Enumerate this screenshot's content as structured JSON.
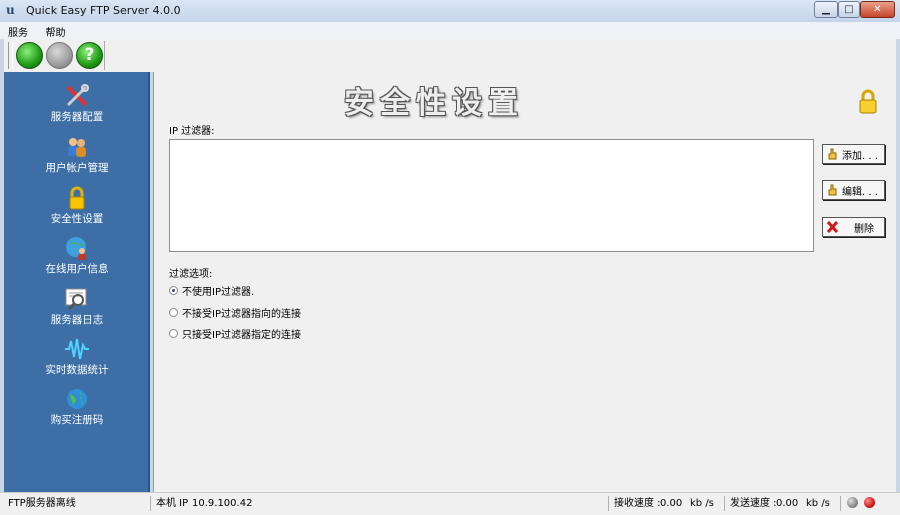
{
  "window": {
    "title": "Quick Easy FTP Server 4.0.0",
    "app_icon": "u-logo-icon"
  },
  "menu": [
    "服务",
    "帮助"
  ],
  "toolbar": {
    "start": "start-server-icon",
    "stop": "stop-server-icon",
    "help": "?"
  },
  "sidebar": {
    "items": [
      {
        "label": "服务器配置",
        "icon": "tools-icon"
      },
      {
        "label": "用户帐户管理",
        "icon": "users-icon"
      },
      {
        "label": "安全性设置",
        "icon": "lock-icon"
      },
      {
        "label": "在线用户信息",
        "icon": "online-users-icon"
      },
      {
        "label": "服务器日志",
        "icon": "log-magnifier-icon"
      },
      {
        "label": "实时数据统计",
        "icon": "waveform-icon"
      },
      {
        "label": "购买注册码",
        "icon": "globe-icon"
      }
    ]
  },
  "main": {
    "heading": "安全性设置",
    "ip_filter_label": "IP 过滤器:",
    "buttons": {
      "add": "添加. . .",
      "edit": "编辑. . .",
      "delete": "删除"
    },
    "filter_options_label": "过滤选项:",
    "options": [
      {
        "label": "不使用IP过滤器.",
        "selected": true
      },
      {
        "label": "不接受IP过滤器指向的连接",
        "selected": false
      },
      {
        "label": "只接受IP过滤器指定的连接",
        "selected": false
      }
    ]
  },
  "status": {
    "server_state": "FTP服务器离线",
    "ip_label": "本机 IP",
    "ip": "10.9.100.42",
    "recv_label": "接收速度 :",
    "recv_value": "0.00",
    "recv_unit": "kb /s",
    "send_label": "发送速度 :",
    "send_value": "0.00",
    "send_unit": "kb /s"
  },
  "colors": {
    "sidebar": "#3d6fa6",
    "led_gray": "#8a8a8a",
    "led_red": "#d21a1a",
    "go_green": "#1f9a14"
  }
}
